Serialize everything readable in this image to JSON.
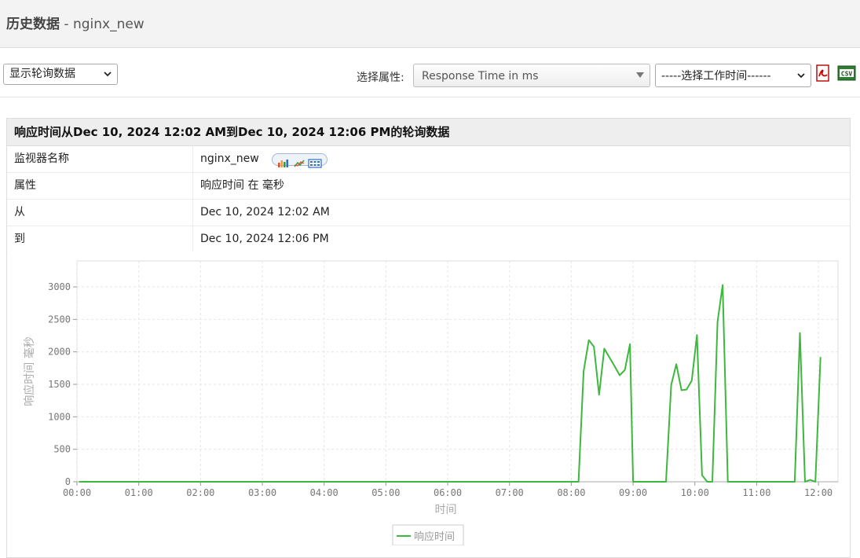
{
  "header": {
    "title_prefix": "历史数据",
    "title_sep": " - ",
    "monitor": "nginx_new"
  },
  "toolbar": {
    "view_select": "显示轮询数据",
    "attr_label": "选择属性:",
    "attr_select": "Response Time in ms",
    "time_select": "-----选择工作时间------",
    "pdf_icon": "pdf-icon",
    "csv_icon": "csv-icon"
  },
  "panel": {
    "title": "响应时间从Dec 10, 2024 12:02 AM到Dec 10, 2024 12:06 PM的轮询数据",
    "rows": [
      {
        "key": "监视器名称",
        "value": "nginx_new"
      },
      {
        "key": "属性",
        "value": "响应时间 在 毫秒"
      },
      {
        "key": "从",
        "value": "Dec 10, 2024 12:02 AM"
      },
      {
        "key": "到",
        "value": "Dec 10, 2024 12:06 PM"
      }
    ]
  },
  "chart_data": {
    "type": "line",
    "xlabel": "时间",
    "ylabel": "响应时间 毫秒",
    "ylim": [
      0,
      3400
    ],
    "yticks": [
      0,
      500,
      1000,
      1500,
      2000,
      2500,
      3000
    ],
    "xlim": [
      "00:00",
      "12:19"
    ],
    "xticks": [
      "00:00",
      "01:00",
      "02:00",
      "03:00",
      "04:00",
      "05:00",
      "06:00",
      "07:00",
      "08:00",
      "09:00",
      "10:00",
      "11:00",
      "12:00"
    ],
    "grid": true,
    "legend": "bottom-center",
    "color": "#3db83d",
    "series": [
      {
        "name": "响应时间",
        "points": [
          [
            "00:02",
            0
          ],
          [
            "08:07",
            0
          ],
          [
            "08:12",
            1700
          ],
          [
            "08:17",
            2180
          ],
          [
            "08:22",
            2080
          ],
          [
            "08:27",
            1340
          ],
          [
            "08:32",
            2050
          ],
          [
            "08:42",
            1780
          ],
          [
            "08:47",
            1640
          ],
          [
            "08:52",
            1720
          ],
          [
            "08:57",
            2120
          ],
          [
            "09:00",
            0
          ],
          [
            "09:32",
            0
          ],
          [
            "09:37",
            1490
          ],
          [
            "09:42",
            1810
          ],
          [
            "09:47",
            1410
          ],
          [
            "09:52",
            1420
          ],
          [
            "09:57",
            1560
          ],
          [
            "10:02",
            2260
          ],
          [
            "10:07",
            100
          ],
          [
            "10:12",
            0
          ],
          [
            "10:17",
            0
          ],
          [
            "10:22",
            2460
          ],
          [
            "10:27",
            3030
          ],
          [
            "10:32",
            0
          ],
          [
            "11:37",
            0
          ],
          [
            "11:42",
            2290
          ],
          [
            "11:47",
            0
          ],
          [
            "11:52",
            30
          ],
          [
            "11:57",
            0
          ],
          [
            "12:02",
            1920
          ]
        ]
      }
    ]
  }
}
